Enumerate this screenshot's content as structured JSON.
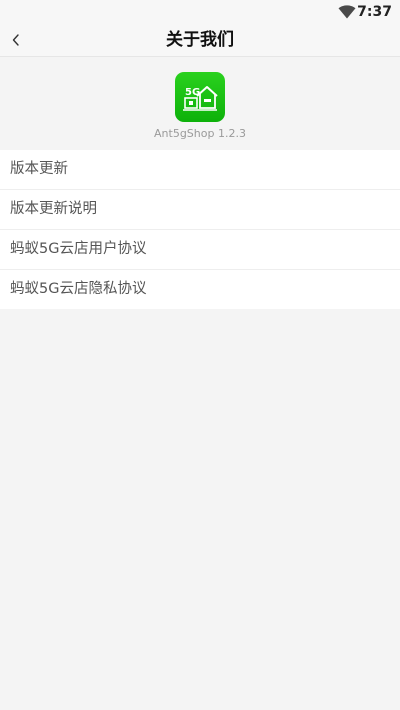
{
  "status_bar": {
    "time": "7:37",
    "wifi_icon": "wifi-icon"
  },
  "app_bar": {
    "back_icon": "chevron-left-icon",
    "title": "关于我们"
  },
  "app_info": {
    "logo_icon": "ant5gshop-logo-icon",
    "logo_text": "5G",
    "version_text": "Ant5gShop 1.2.3"
  },
  "menu": {
    "items": [
      {
        "label": "版本更新"
      },
      {
        "label": "版本更新说明"
      },
      {
        "label": "蚂蚁5G云店用户协议"
      },
      {
        "label": "蚂蚁5G云店隐私协议"
      }
    ]
  },
  "colors": {
    "background": "#f4f4f4",
    "app_bar": "#f7f7f7",
    "logo_green": "#0db10a",
    "menu_text": "#555555",
    "version_text": "#9a9a9a"
  }
}
